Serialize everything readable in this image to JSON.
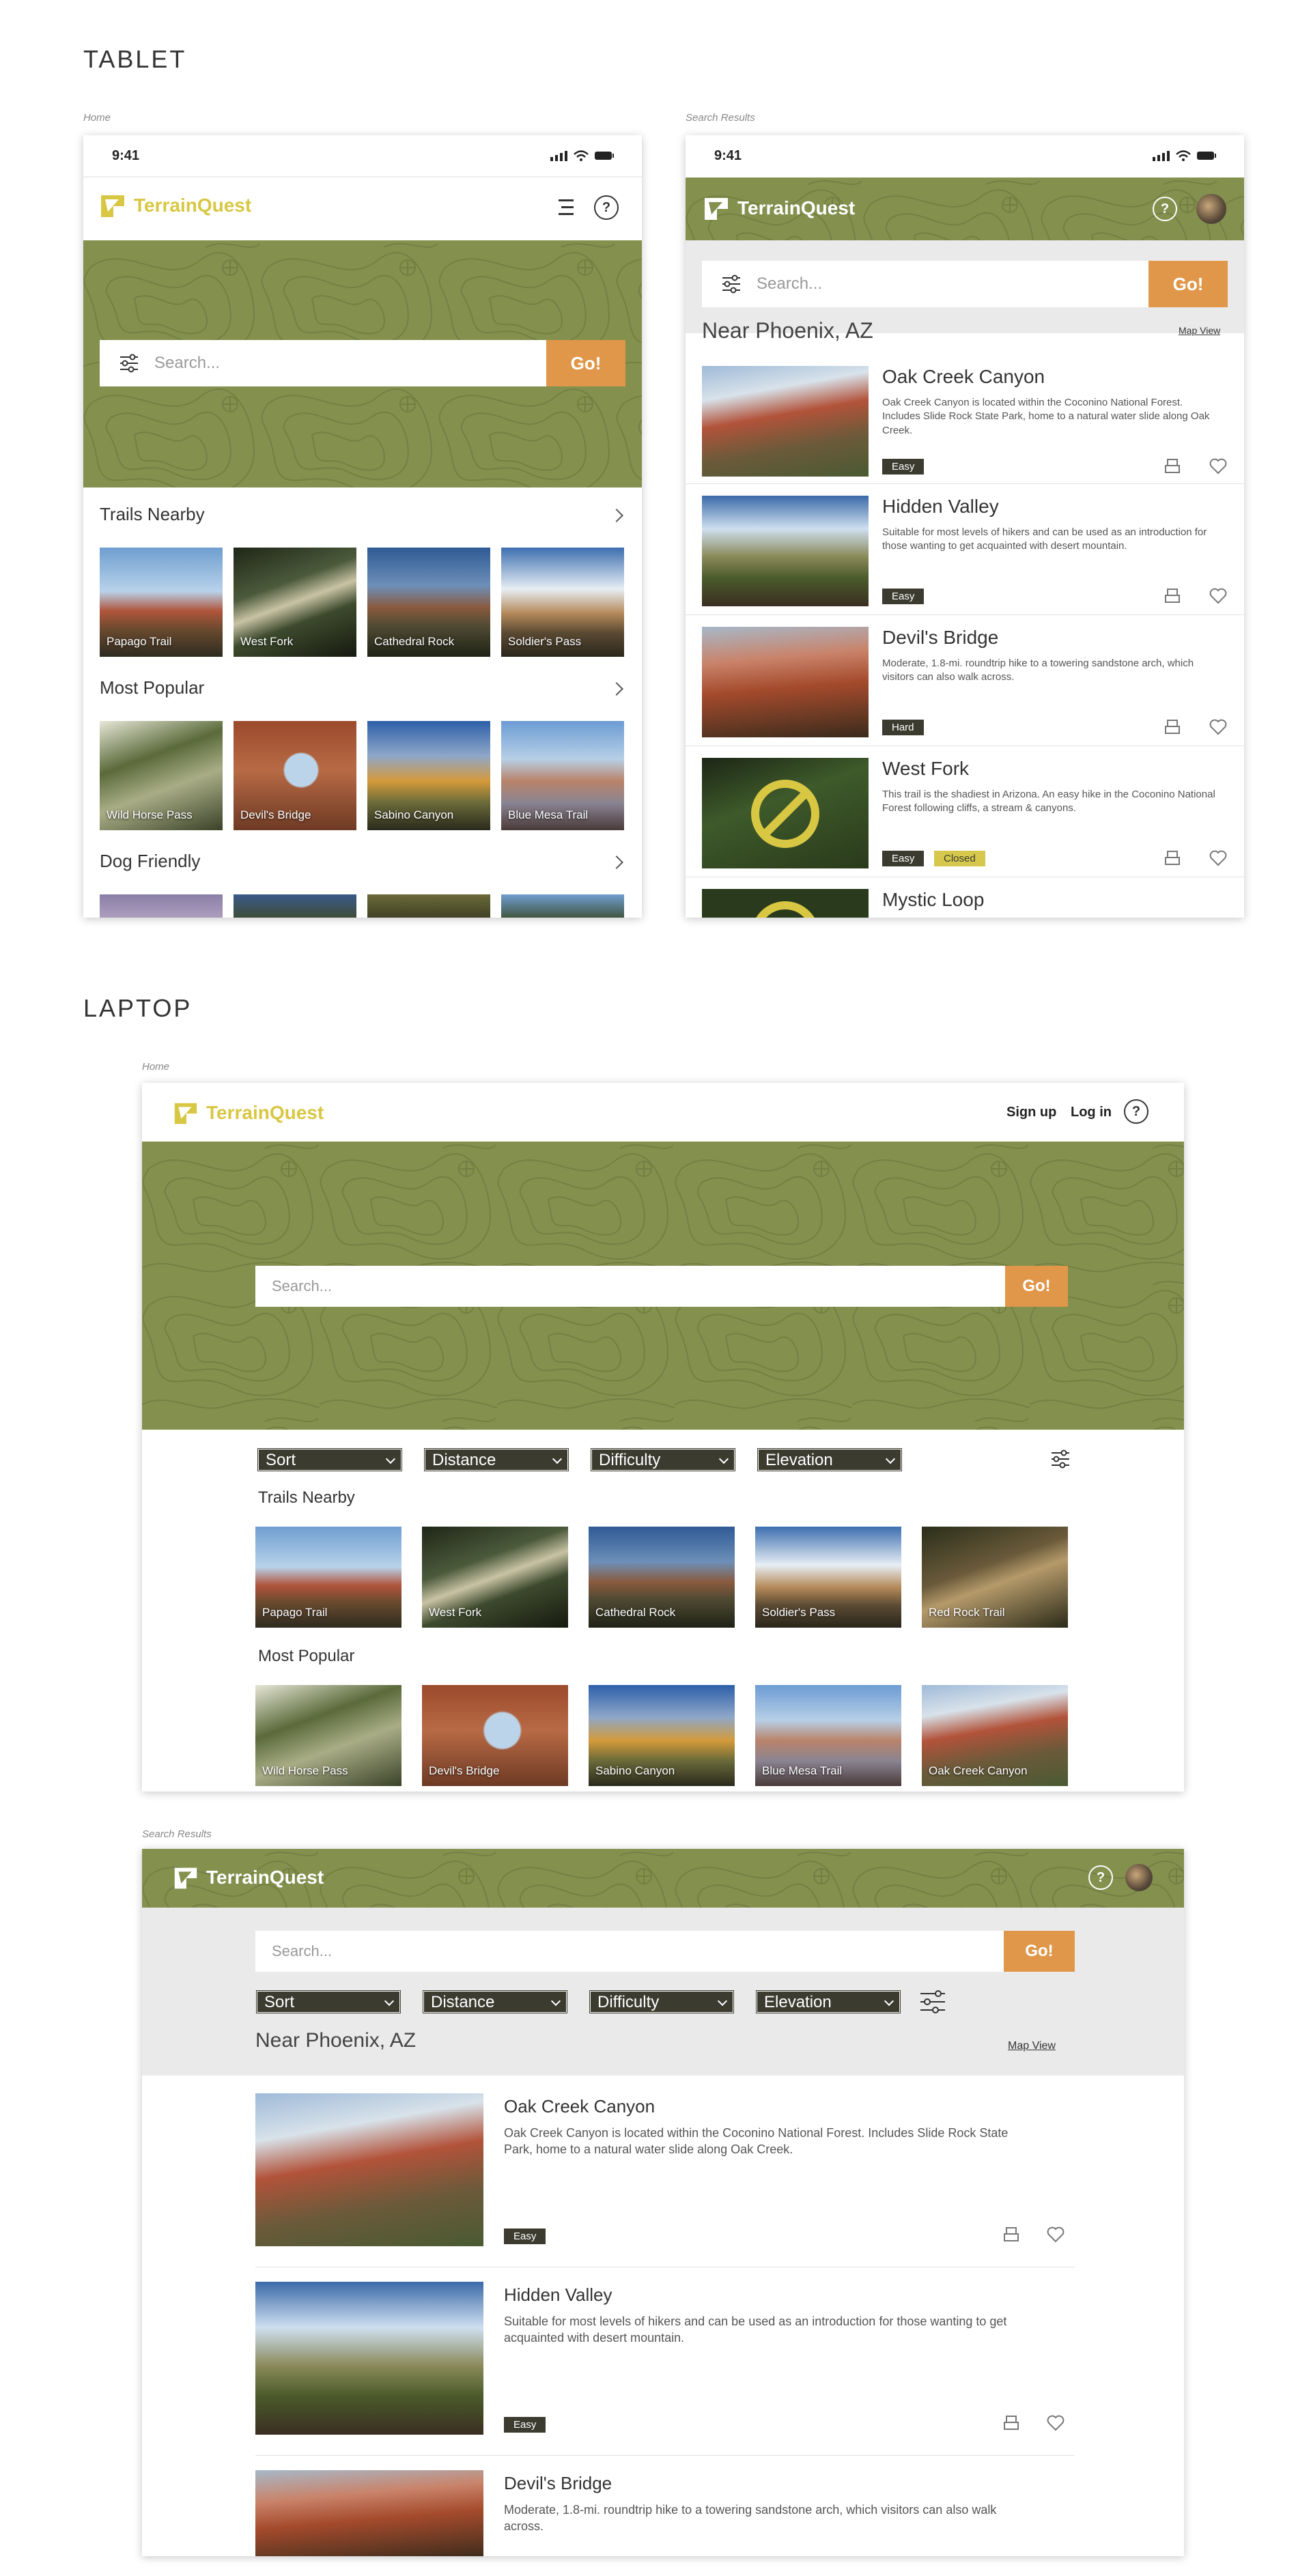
{
  "sections": {
    "tablet": "TABLET",
    "laptop": "LAPTOP"
  },
  "captions": {
    "tablet_home": "Home",
    "tablet_results": "Search Results",
    "laptop_home": "Home",
    "laptop_results": "Search Results"
  },
  "status_time": "9:41",
  "brand": {
    "name": "TerrainQuest",
    "accent": "#d8c743",
    "olive": "#84904e",
    "dark": "#3c3b30",
    "orange": "#e0974a"
  },
  "search": {
    "placeholder": "Search...",
    "go_label": "Go!"
  },
  "nav": {
    "sign_up": "Sign up",
    "log_in": "Log in",
    "help": "?"
  },
  "location": {
    "title": "Near Phoenix, AZ",
    "map_view": "Map View"
  },
  "filters": [
    "Sort",
    "Distance",
    "Difficulty",
    "Elevation"
  ],
  "categories": {
    "trails_nearby": "Trails Nearby",
    "most_popular": "Most Popular",
    "dog_friendly": "Dog Friendly"
  },
  "trails_nearby": [
    "Papago Trail",
    "West Fork",
    "Cathedral Rock",
    "Soldier's Pass",
    "Red Rock Trail"
  ],
  "most_popular": [
    "Wild Horse Pass",
    "Devil's Bridge",
    "Sabino Canyon",
    "Blue Mesa Trail",
    "Oak Creek Canyon"
  ],
  "results": [
    {
      "title": "Oak Creek Canyon",
      "desc": "Oak Creek Canyon is located within the Coconino National Forest. Includes Slide Rock State Park, home to a natural water slide along Oak Creek.",
      "difficulty": "Easy",
      "closed": ""
    },
    {
      "title": "Hidden Valley",
      "desc": "Suitable for most levels of hikers and can be used as an introduction for those wanting to get acquainted with desert mountain.",
      "difficulty": "Easy",
      "closed": ""
    },
    {
      "title": "Devil's Bridge",
      "desc": "Moderate, 1.8-mi. roundtrip hike to a towering sandstone arch, which visitors can also walk across.",
      "difficulty": "Hard",
      "closed": ""
    },
    {
      "title": "West Fork",
      "desc": "This trail is the shadiest in Arizona. An easy hike in the Coconino National Forest following cliffs, a stream & canyons.",
      "difficulty": "Easy",
      "closed": "Closed"
    },
    {
      "title": "Mystic Loop",
      "desc": "",
      "difficulty": "",
      "closed": ""
    }
  ]
}
